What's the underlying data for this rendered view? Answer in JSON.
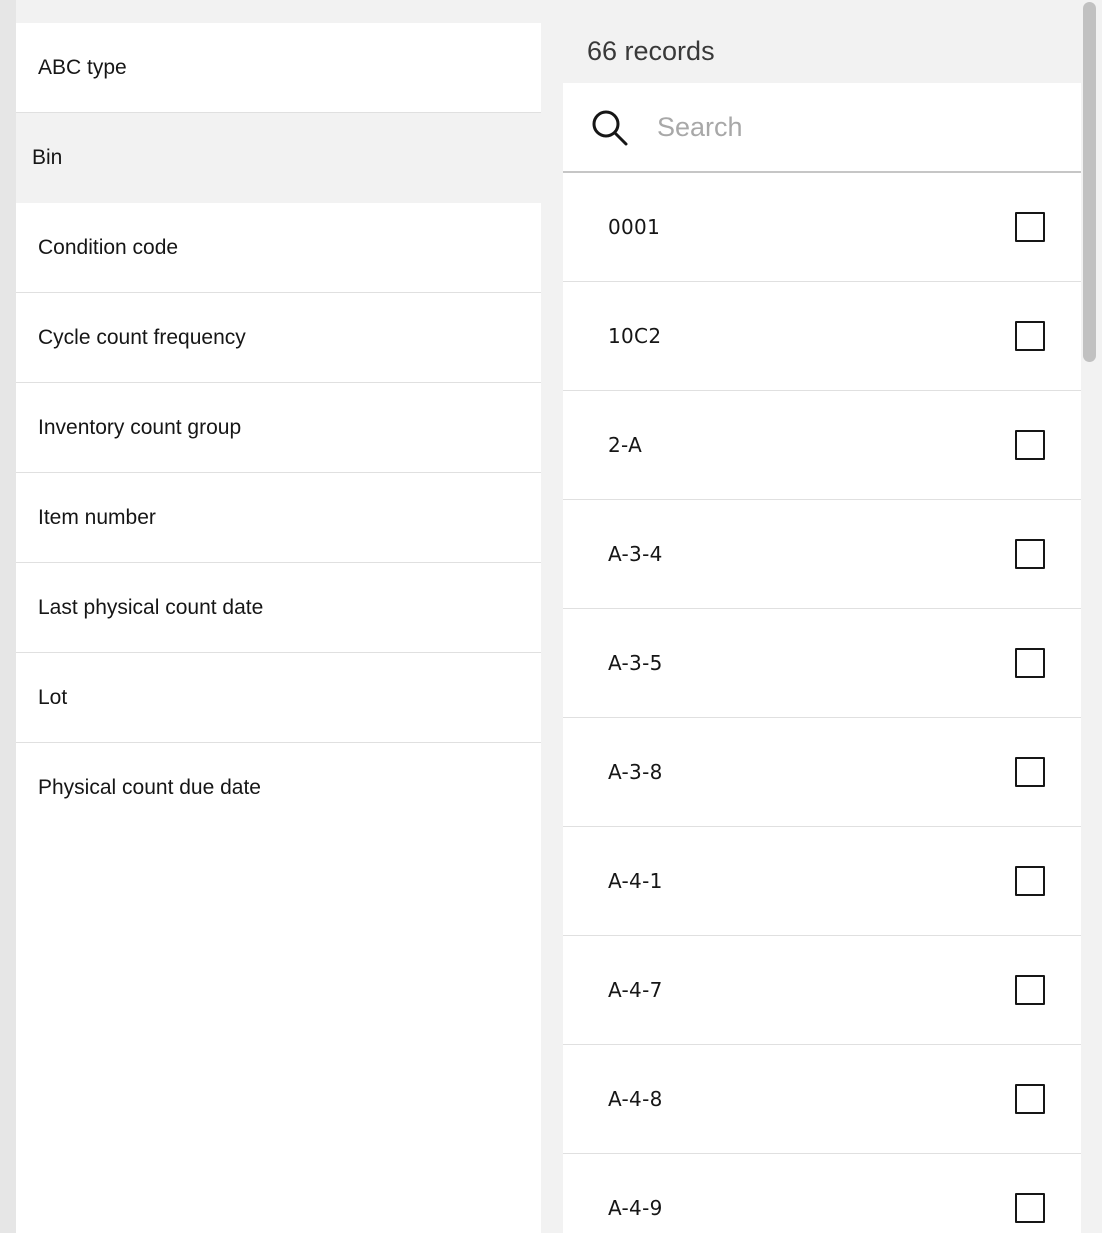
{
  "categories": [
    {
      "label": "ABC type",
      "selected": false
    },
    {
      "label": "Bin",
      "selected": true
    },
    {
      "label": "Condition code",
      "selected": false
    },
    {
      "label": "Cycle count frequency",
      "selected": false
    },
    {
      "label": "Inventory count group",
      "selected": false
    },
    {
      "label": "Item number",
      "selected": false
    },
    {
      "label": "Last physical count date",
      "selected": false
    },
    {
      "label": "Lot",
      "selected": false
    },
    {
      "label": "Physical count due date",
      "selected": false
    }
  ],
  "records": {
    "count_label": "66 records"
  },
  "search": {
    "icon": "search-icon",
    "placeholder": "Search",
    "value": ""
  },
  "values": [
    {
      "label": "0001",
      "checked": false
    },
    {
      "label": "10C2",
      "checked": false
    },
    {
      "label": "2-A",
      "checked": false
    },
    {
      "label": "A-3-4",
      "checked": false
    },
    {
      "label": "A-3-5",
      "checked": false
    },
    {
      "label": "A-3-8",
      "checked": false
    },
    {
      "label": "A-4-1",
      "checked": false
    },
    {
      "label": "A-4-7",
      "checked": false
    },
    {
      "label": "A-4-8",
      "checked": false
    },
    {
      "label": "A-4-9",
      "checked": false
    }
  ],
  "colors": {
    "background": "#f2f2f2",
    "panel": "#ffffff",
    "text": "#161616",
    "placeholder": "#a8a8a8",
    "divider": "#e0e0e0",
    "scrollbar_thumb": "#c1c1c1"
  }
}
